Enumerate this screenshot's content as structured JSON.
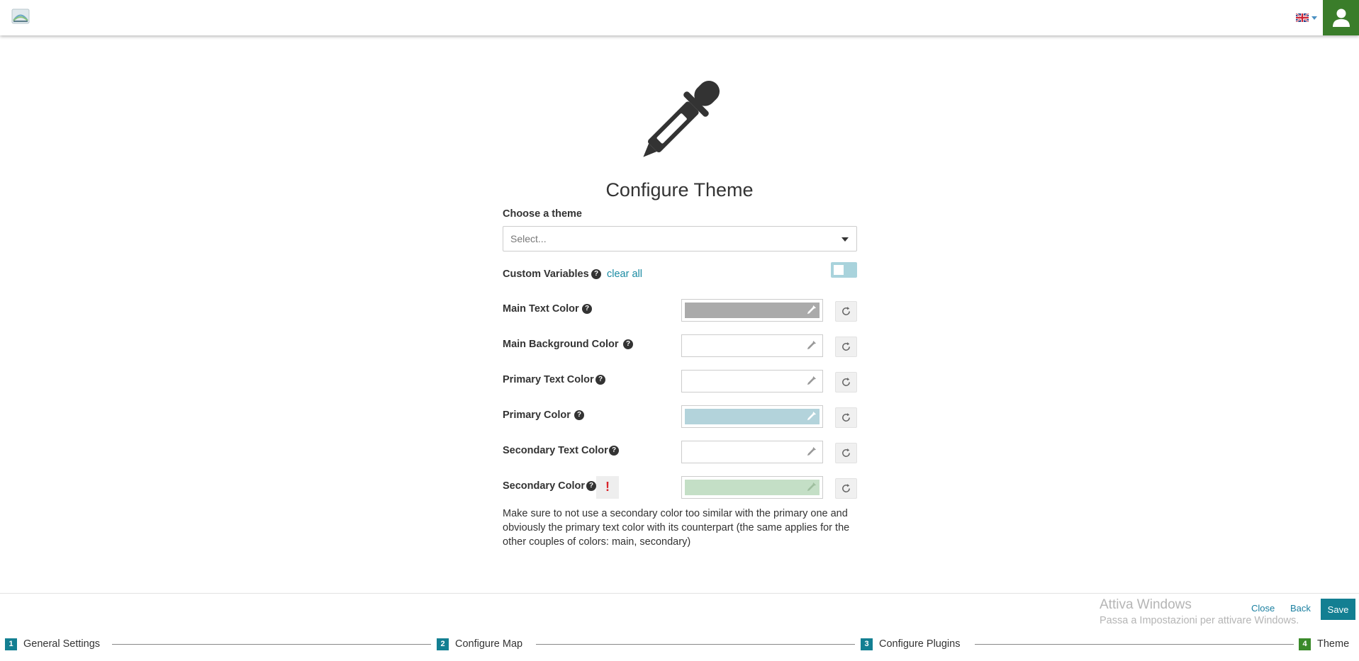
{
  "header": {
    "language": "English",
    "user_menu_label": ""
  },
  "main": {
    "title": "Configure Theme",
    "theme_select": {
      "label": "Choose a theme",
      "placeholder": "Select..."
    },
    "custom_variables": {
      "label": "Custom Variables",
      "clear_all": "clear all",
      "enabled": false
    },
    "colors": [
      {
        "label": "Main Text Color",
        "value": "#aaaaaa",
        "set": true
      },
      {
        "label": "Main Background Color",
        "value": "",
        "set": false
      },
      {
        "label": "Primary Text Color",
        "value": "",
        "set": false
      },
      {
        "label": "Primary Color",
        "value": "#b3d3db",
        "set": true
      },
      {
        "label": "Secondary Text Color",
        "value": "",
        "set": false
      },
      {
        "label": "Secondary Color",
        "value": "#c4dfc6",
        "set": true,
        "warning": "!"
      }
    ],
    "note": "Make sure to not use a secondary color too similar with the primary one and obviously the primary text color with its counterpart (the same applies for the other couples of colors: main, secondary)"
  },
  "footer": {
    "watermark_title": "Attiva Windows",
    "watermark_sub": "Passa a Impostazioni per attivare Windows.",
    "close": "Close",
    "back": "Back",
    "save": "Save",
    "steps": [
      {
        "num": "1",
        "label": "General Settings",
        "active": false
      },
      {
        "num": "2",
        "label": "Configure Map",
        "active": false
      },
      {
        "num": "3",
        "label": "Configure Plugins",
        "active": false
      },
      {
        "num": "4",
        "label": "Theme",
        "active": true
      }
    ]
  },
  "colors_theme": {
    "accent": "#137f92",
    "link": "#1a8ba3",
    "user_button": "#3a7d2a",
    "warning": "#d9252c"
  },
  "icons": [
    "app-logo-icon",
    "uk-flag-icon",
    "user-icon",
    "eyedropper-icon",
    "help-icon",
    "refresh-icon",
    "warning-icon"
  ]
}
